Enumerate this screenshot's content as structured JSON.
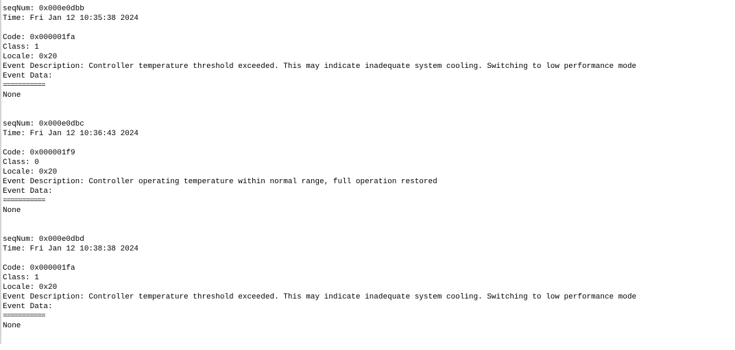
{
  "entries": [
    {
      "seqnum": "seqNum: 0x000e0dbb",
      "time": "Time: Fri Jan 12 10:35:38 2024",
      "code": "Code: 0x000001fa",
      "class": "Class: 1",
      "locale": "Locale: 0x20",
      "description": "Event Description: Controller temperature threshold exceeded. This may indicate inadequate system cooling. Switching to low performance mode",
      "event_data_label": "Event Data:",
      "separator": "===========",
      "event_data": "None"
    },
    {
      "seqnum": "seqNum: 0x000e0dbc",
      "time": "Time: Fri Jan 12 10:36:43 2024",
      "code": "Code: 0x000001f9",
      "class": "Class: 0",
      "locale": "Locale: 0x20",
      "description": "Event Description: Controller operating temperature within normal range, full operation restored",
      "event_data_label": "Event Data:",
      "separator": "===========",
      "event_data": "None"
    },
    {
      "seqnum": "seqNum: 0x000e0dbd",
      "time": "Time: Fri Jan 12 10:38:38 2024",
      "code": "Code: 0x000001fa",
      "class": "Class: 1",
      "locale": "Locale: 0x20",
      "description": "Event Description: Controller temperature threshold exceeded. This may indicate inadequate system cooling. Switching to low performance mode",
      "event_data_label": "Event Data:",
      "separator": "===========",
      "event_data": "None"
    }
  ]
}
